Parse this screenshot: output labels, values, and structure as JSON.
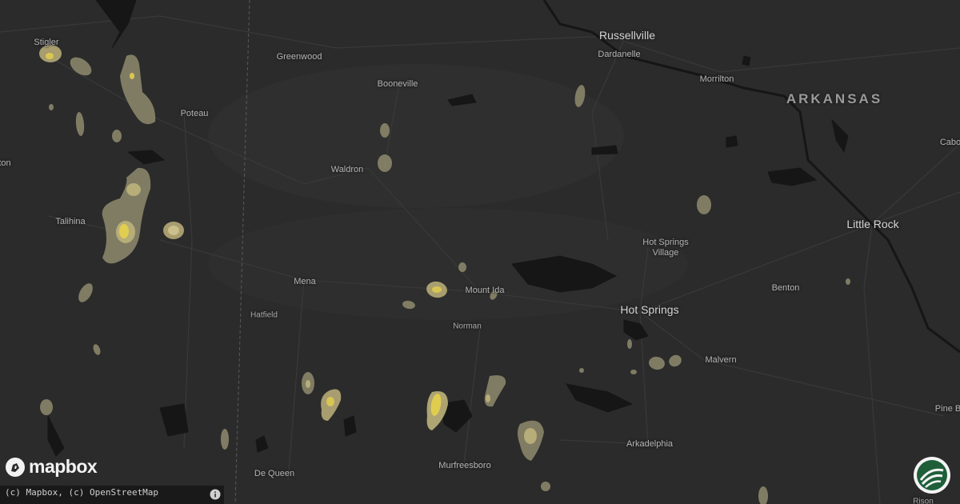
{
  "map": {
    "state_label": "ARKANSAS",
    "places": [
      {
        "name": "Stigler",
        "size": "med"
      },
      {
        "name": "Greenwood",
        "size": "med"
      },
      {
        "name": "Russellville",
        "size": "big"
      },
      {
        "name": "Dardanelle",
        "size": "med"
      },
      {
        "name": "Booneville",
        "size": "med"
      },
      {
        "name": "Morrilton",
        "size": "med"
      },
      {
        "name": "Poteau",
        "size": "med"
      },
      {
        "name": "Waldron",
        "size": "med"
      },
      {
        "name": "Cabo",
        "size": "med"
      },
      {
        "name": "ton",
        "size": "med"
      },
      {
        "name": "Talihina",
        "size": "med"
      },
      {
        "name": "Little Rock",
        "size": "big"
      },
      {
        "name": "Hot Springs",
        "size": "med"
      },
      {
        "name": "Village",
        "size": "med"
      },
      {
        "name": "Mena",
        "size": "med"
      },
      {
        "name": "Mount Ida",
        "size": "med"
      },
      {
        "name": "Benton",
        "size": "med"
      },
      {
        "name": "Hot Springs",
        "size": "big"
      },
      {
        "name": "Hatfield",
        "size": "small"
      },
      {
        "name": "Norman",
        "size": "small"
      },
      {
        "name": "Malvern",
        "size": "med"
      },
      {
        "name": "Pine B",
        "size": "med"
      },
      {
        "name": "Arkadelphia",
        "size": "med"
      },
      {
        "name": "Murfreesboro",
        "size": "med"
      },
      {
        "name": "De Queen",
        "size": "med"
      },
      {
        "name": "Rison",
        "size": "small"
      }
    ],
    "colors": {
      "background": "#2b2b2b",
      "water": "#161616",
      "road": "#3a3a3a",
      "hail_light": "#8f8b6e",
      "hail_mid": "#bdb27a",
      "hail_core": "#e3cf4e"
    }
  },
  "logo": {
    "text": "mapbox",
    "icon": "mapbox-logo-icon"
  },
  "attribution": {
    "text": "(c) Mapbox, (c) OpenStreetMap",
    "icon": "info-icon"
  },
  "badge": {
    "icon": "hail-brand-icon"
  }
}
